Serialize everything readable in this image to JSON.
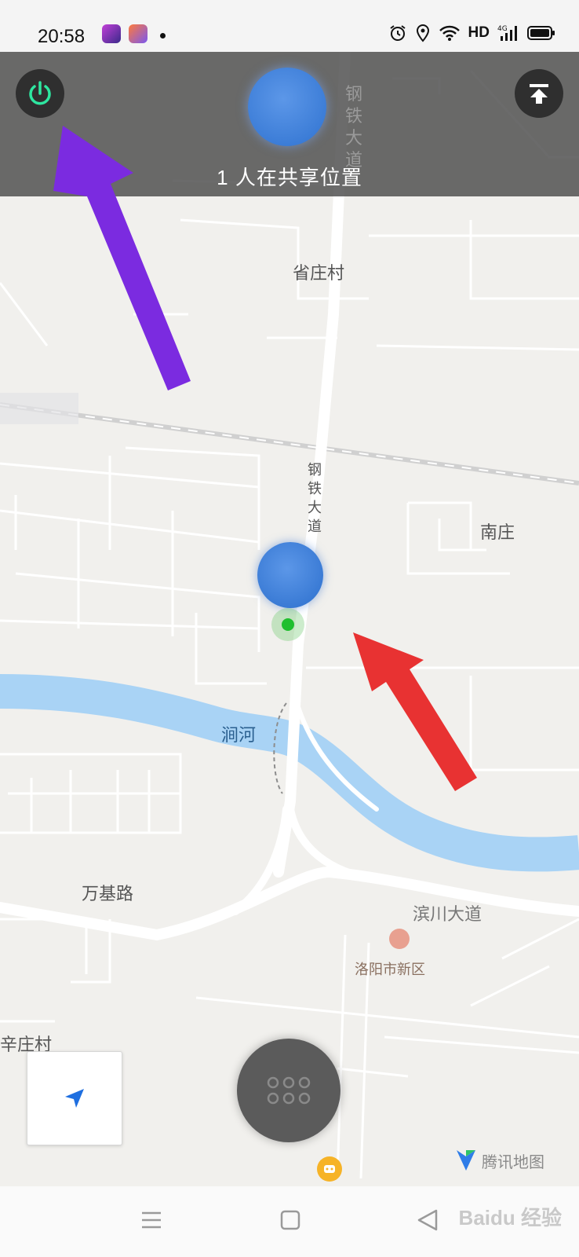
{
  "status_bar": {
    "time": "20:58",
    "network": "HD",
    "icons": [
      "alarm-icon",
      "location-pin-icon",
      "wifi-icon",
      "signal-4g-icon",
      "battery-icon"
    ]
  },
  "share_panel": {
    "sharing_text": "1 人在共享位置",
    "left_button_icon": "power-icon",
    "right_button_icon": "upload-to-top-icon"
  },
  "map": {
    "labels": {
      "steel_road": "钢铁大道",
      "village_top": "省庄村",
      "road_mid": "钢铁大道",
      "nanzhuang": "南庄",
      "river": "涧河",
      "wanji_road": "万基路",
      "river_road": "滨川大道",
      "village_bottom": "辛庄村",
      "poi": "洛阳市新区"
    },
    "logo_text": "腾讯地图"
  },
  "colors": {
    "overlay": "#4b4b4b",
    "power_accent": "#2ee6a0",
    "river": "#a9d3f5",
    "purple_arrow": "#7b2be0",
    "red_arrow": "#e83232",
    "locate_arrow": "#1f6fe0"
  },
  "watermark": "Baidu 经验"
}
